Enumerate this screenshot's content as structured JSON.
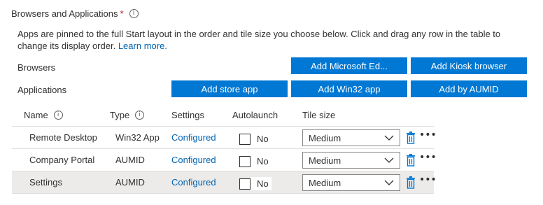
{
  "section": {
    "title": "Browsers and Applications",
    "required_marker": "*",
    "info_glyph": "i",
    "description": "Apps are pinned to the full Start layout in the order and tile size you choose below. Click and drag any row in the table to change its display order.",
    "learn_more": "Learn more."
  },
  "browsers": {
    "label": "Browsers",
    "buttons": [
      "Add Microsoft Ed...",
      "Add Kiosk browser"
    ]
  },
  "applications": {
    "label": "Applications",
    "buttons": [
      "Add store app",
      "Add Win32 app",
      "Add by AUMID"
    ]
  },
  "table": {
    "columns": {
      "name": "Name",
      "type": "Type",
      "settings": "Settings",
      "autolaunch": "Autolaunch",
      "tile_size": "Tile size"
    },
    "rows": [
      {
        "name": "Remote Desktop",
        "type": "Win32 App",
        "settings": "Configured",
        "autolaunch_label": "No",
        "tile_size": "Medium",
        "selected": false
      },
      {
        "name": "Company Portal",
        "type": "AUMID",
        "settings": "Configured",
        "autolaunch_label": "No",
        "tile_size": "Medium",
        "selected": false
      },
      {
        "name": "Settings",
        "type": "AUMID",
        "settings": "Configured",
        "autolaunch_label": "No",
        "tile_size": "Medium",
        "selected": true
      }
    ],
    "more_glyph": "•••"
  },
  "colors": {
    "primary_button": "#0078d4",
    "link": "#0063b1",
    "required": "#a4262c",
    "selected_row": "#edebe9",
    "trash_icon": "#0078d4"
  },
  "icons": {
    "info": "info-icon",
    "chevron": "chevron-down-icon",
    "delete": "trash-icon",
    "more": "more-horizontal-icon"
  }
}
